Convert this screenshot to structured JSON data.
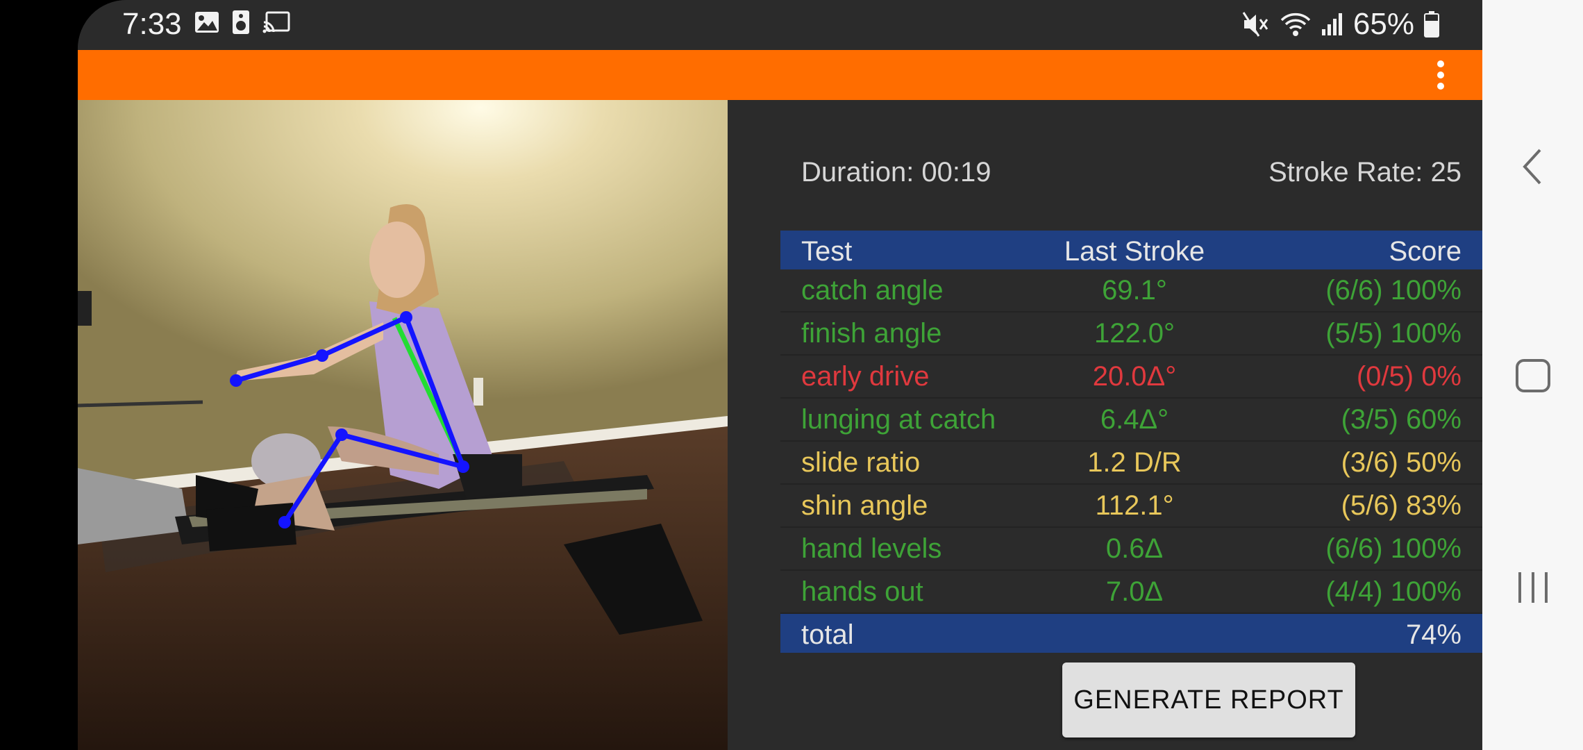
{
  "status_bar": {
    "time": "7:33",
    "battery": "65%",
    "icons_left": [
      "image-icon",
      "speaker-icon",
      "cast-icon"
    ],
    "icons_right": [
      "mute-icon",
      "wifi-icon",
      "signal-icon",
      "battery-icon"
    ]
  },
  "app_bar": {
    "color": "#ff6d00",
    "menu_icon": "overflow-menu-icon"
  },
  "metrics": {
    "duration": "Duration: 00:19",
    "stroke_rate": "Stroke Rate: 25"
  },
  "table": {
    "headers": [
      "Test",
      "Last Stroke",
      "Score"
    ],
    "rows": [
      {
        "test": "catch angle",
        "last": "69.1°",
        "score": "(6/6) 100%",
        "color": "#3ea337"
      },
      {
        "test": "finish angle",
        "last": "122.0°",
        "score": "(5/5) 100%",
        "color": "#3ea337"
      },
      {
        "test": "early drive",
        "last": "20.0Δ°",
        "score": "(0/5) 0%",
        "color": "#e0393e"
      },
      {
        "test": "lunging at catch",
        "last": "6.4Δ°",
        "score": "(3/5) 60%",
        "color": "#3ea337"
      },
      {
        "test": "slide ratio",
        "last": "1.2 D/R",
        "score": "(3/6) 50%",
        "color": "#e8c75a"
      },
      {
        "test": "shin angle",
        "last": "112.1°",
        "score": "(5/6) 83%",
        "color": "#e8c75a"
      },
      {
        "test": "hand levels",
        "last": "0.6Δ",
        "score": "(6/6) 100%",
        "color": "#3ea337"
      },
      {
        "test": "hands out",
        "last": "7.0Δ",
        "score": "(4/4) 100%",
        "color": "#3ea337"
      }
    ],
    "footer": {
      "label": "total",
      "value": "74%"
    }
  },
  "generate_button": "GENERATE REPORT",
  "nav": {
    "back": "back-icon",
    "home": "home-icon",
    "recents": "recents-icon"
  }
}
